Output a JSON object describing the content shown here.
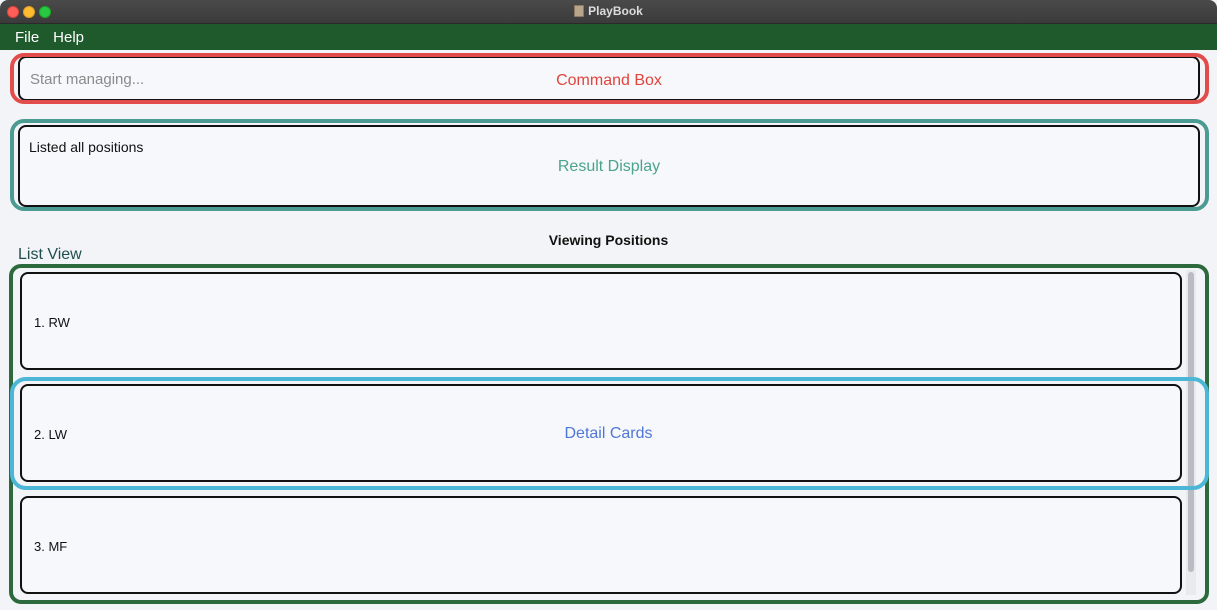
{
  "window": {
    "title": "PlayBook"
  },
  "menu": {
    "items": [
      "File",
      "Help"
    ]
  },
  "command_box": {
    "placeholder": "Start managing...",
    "annotation": "Command Box"
  },
  "result_display": {
    "text": "Listed all positions",
    "annotation": "Result Display"
  },
  "list": {
    "heading": "Viewing Positions",
    "annotation": "List View",
    "cards": [
      "1.  RW",
      "2.  LW",
      "3.  MF"
    ],
    "detail_annotation": "Detail Cards"
  },
  "colors": {
    "menubar": "#1f5a2c",
    "command_box_annotation": "#e24c4a",
    "result_display_annotation": "#4b9b92",
    "list_view_annotation": "#2c6a3d",
    "detail_cards_annotation": "#4bb6d6"
  }
}
